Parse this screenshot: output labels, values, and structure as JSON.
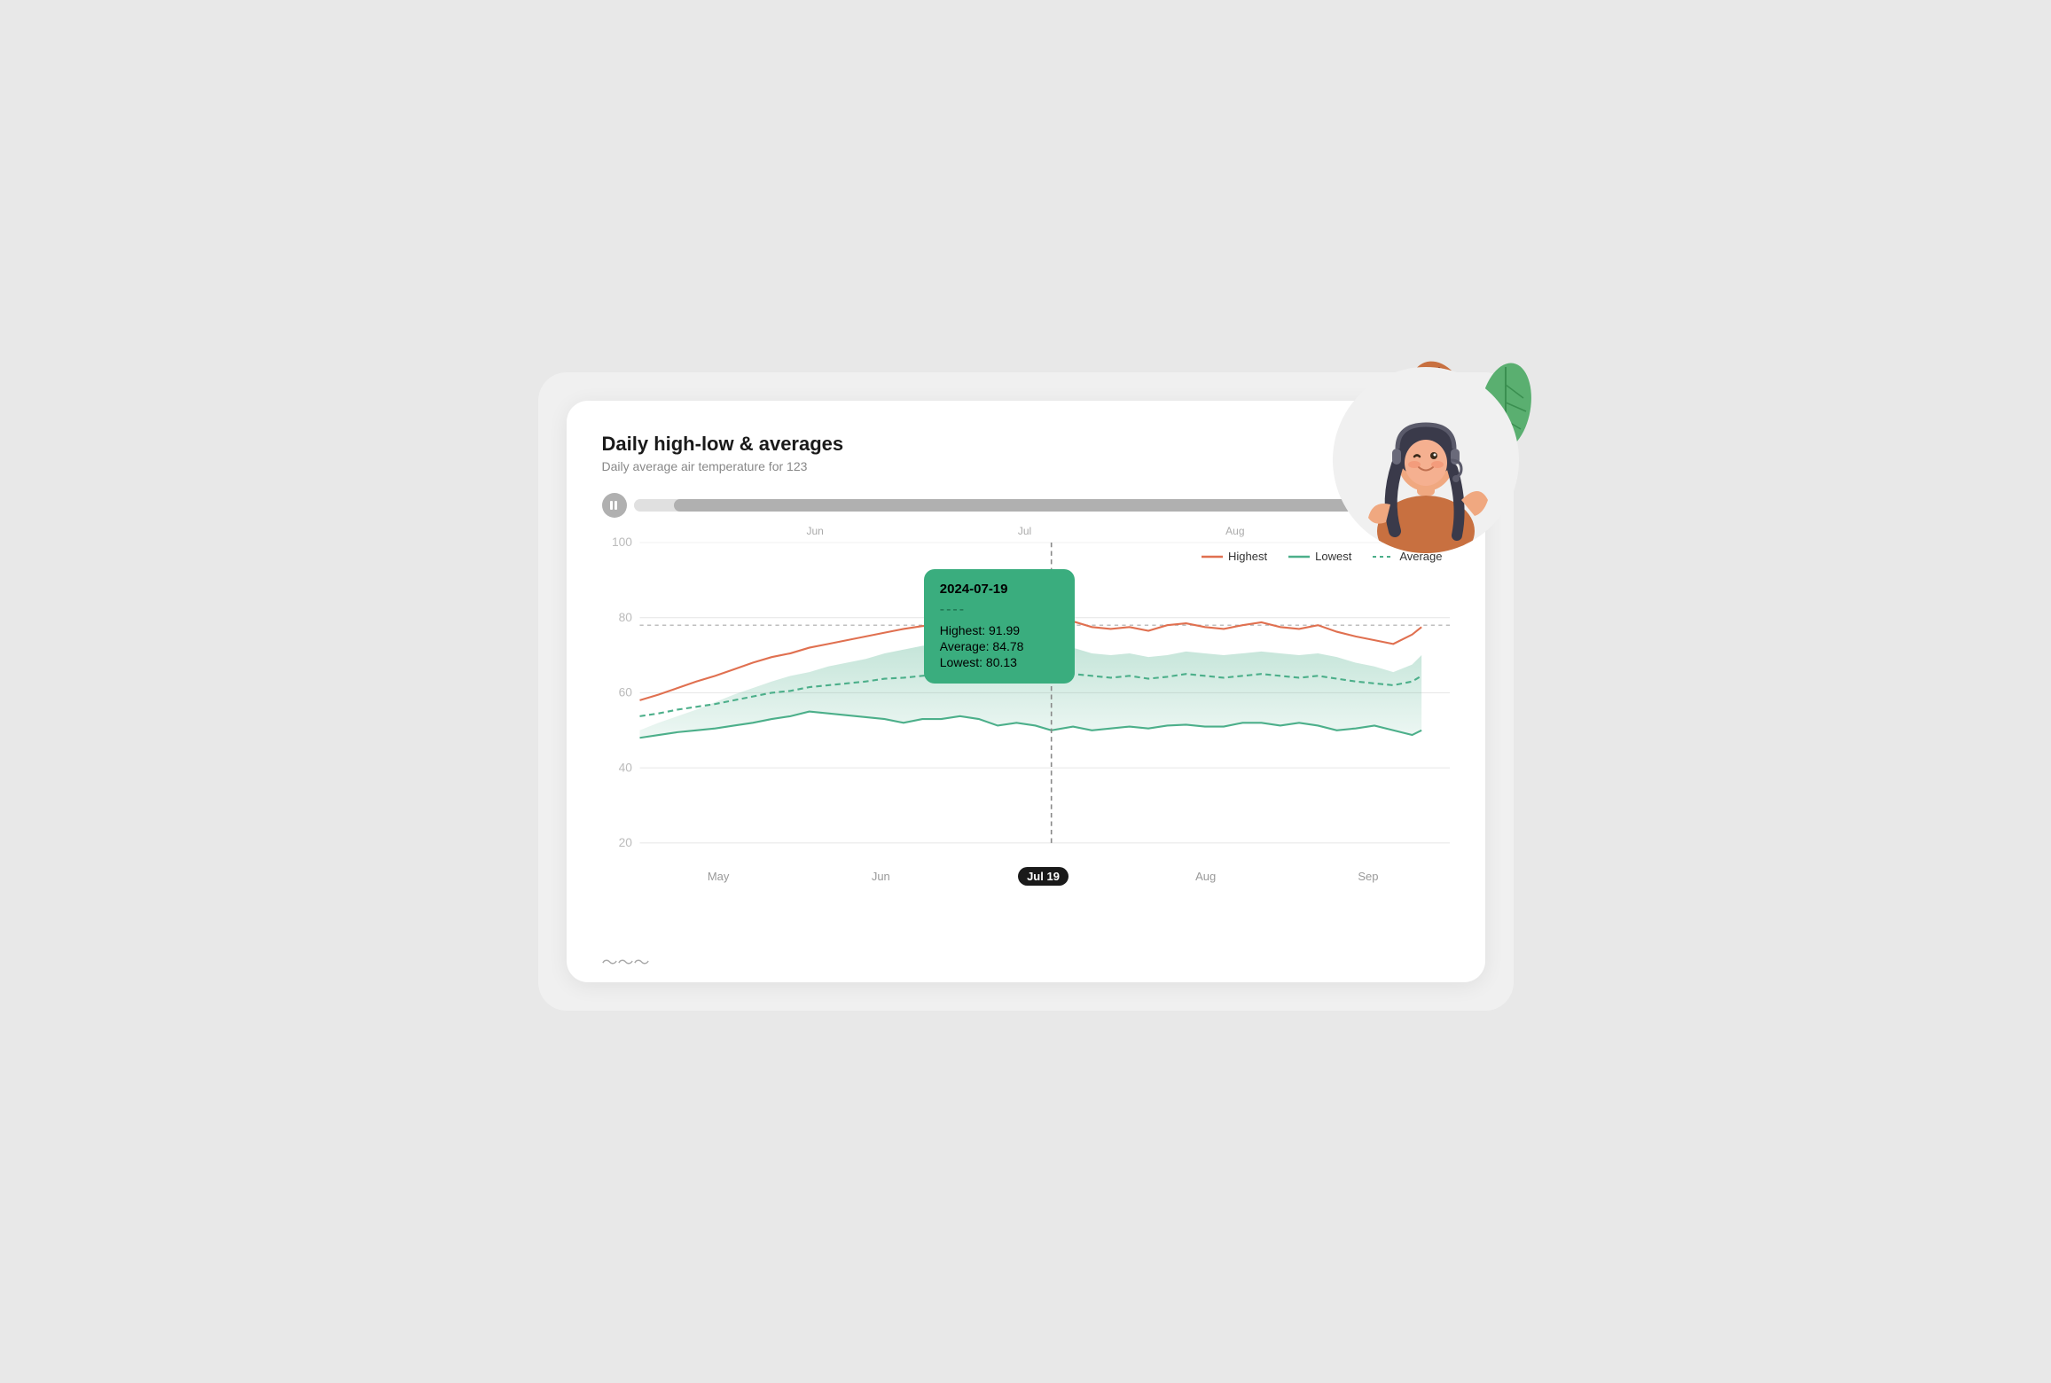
{
  "page": {
    "background": "#e8e8e8"
  },
  "card": {
    "title": "Daily high-low & averages",
    "subtitle": "Daily average air temperature for 123"
  },
  "legend": {
    "highest_label": "Highest",
    "lowest_label": "Lowest",
    "average_label": "Average",
    "highest_color": "#e07050",
    "lowest_color": "#4CAF8A",
    "average_color": "#4CAF8A"
  },
  "tooltip": {
    "date": "2024-07-19",
    "dashes": "----",
    "highest_label": "Highest: 91.99",
    "average_label": "Average: 84.78",
    "lowest_label": "Lowest: 80.13",
    "background": "#3aad7e"
  },
  "x_axis": {
    "labels": [
      "May",
      "Jun",
      "Jul 19",
      "Aug",
      "Sep"
    ],
    "selected": "Jul 19"
  },
  "y_axis": {
    "labels": [
      "100",
      "80",
      "60",
      "40",
      "20"
    ]
  },
  "timeline": {
    "months": [
      "Jun",
      "Jul",
      "Aug"
    ]
  },
  "pause_button": {
    "label": "pause"
  }
}
